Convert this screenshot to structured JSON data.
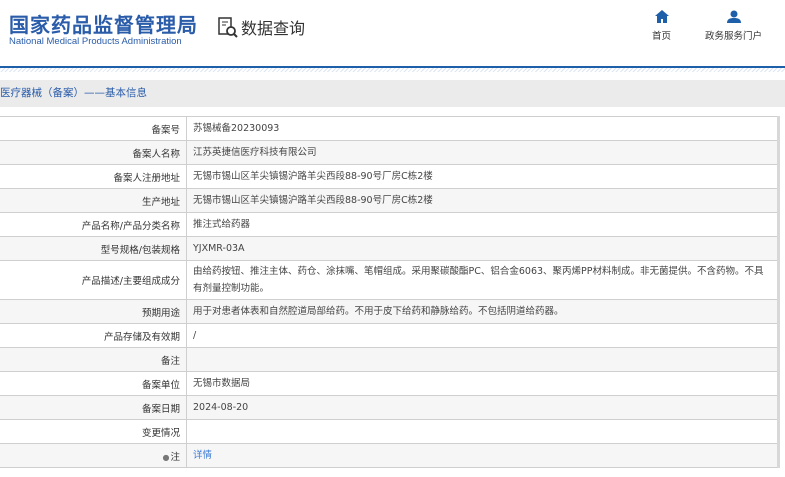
{
  "header": {
    "logo_cn": "国家药品监督管理局",
    "logo_en": "National Medical Products Administration",
    "query_title": "数据查询",
    "nav": [
      {
        "label": "首页",
        "icon": "home-icon"
      },
      {
        "label": "政务服务门户",
        "icon": "user-icon"
      }
    ]
  },
  "breadcrumb": "医疗器械（备案）——基本信息",
  "rows": [
    {
      "label": "备案号",
      "value": "苏锡械备20230093"
    },
    {
      "label": "备案人名称",
      "value": "江苏英捷信医疗科技有限公司"
    },
    {
      "label": "备案人注册地址",
      "value": "无锡市锡山区羊尖镇锡沪路羊尖西段88-90号厂房C栋2楼"
    },
    {
      "label": "生产地址",
      "value": "无锡市锡山区羊尖镇锡沪路羊尖西段88-90号厂房C栋2楼"
    },
    {
      "label": "产品名称/产品分类名称",
      "value": "推注式给药器"
    },
    {
      "label": "型号规格/包装规格",
      "value": "YJXMR-03A"
    },
    {
      "label": "产品描述/主要组成成分",
      "value": "由给药按钮、推注主体、药仓、涂抹嘴、笔帽组成。采用聚碳酸酯PC、铝合金6063、聚丙烯PP材料制成。非无菌提供。不含药物。不具有剂量控制功能。"
    },
    {
      "label": "预期用途",
      "value": "用于对患者体表和自然腔道局部给药。不用于皮下给药和静脉给药。不包括阴道给药器。"
    },
    {
      "label": "产品存储及有效期",
      "value": "/"
    },
    {
      "label": "备注",
      "value": ""
    },
    {
      "label": "备案单位",
      "value": "无锡市数据局"
    },
    {
      "label": "备案日期",
      "value": "2024-08-20"
    },
    {
      "label": "变更情况",
      "value": ""
    },
    {
      "label": "注",
      "value": "详情"
    }
  ]
}
